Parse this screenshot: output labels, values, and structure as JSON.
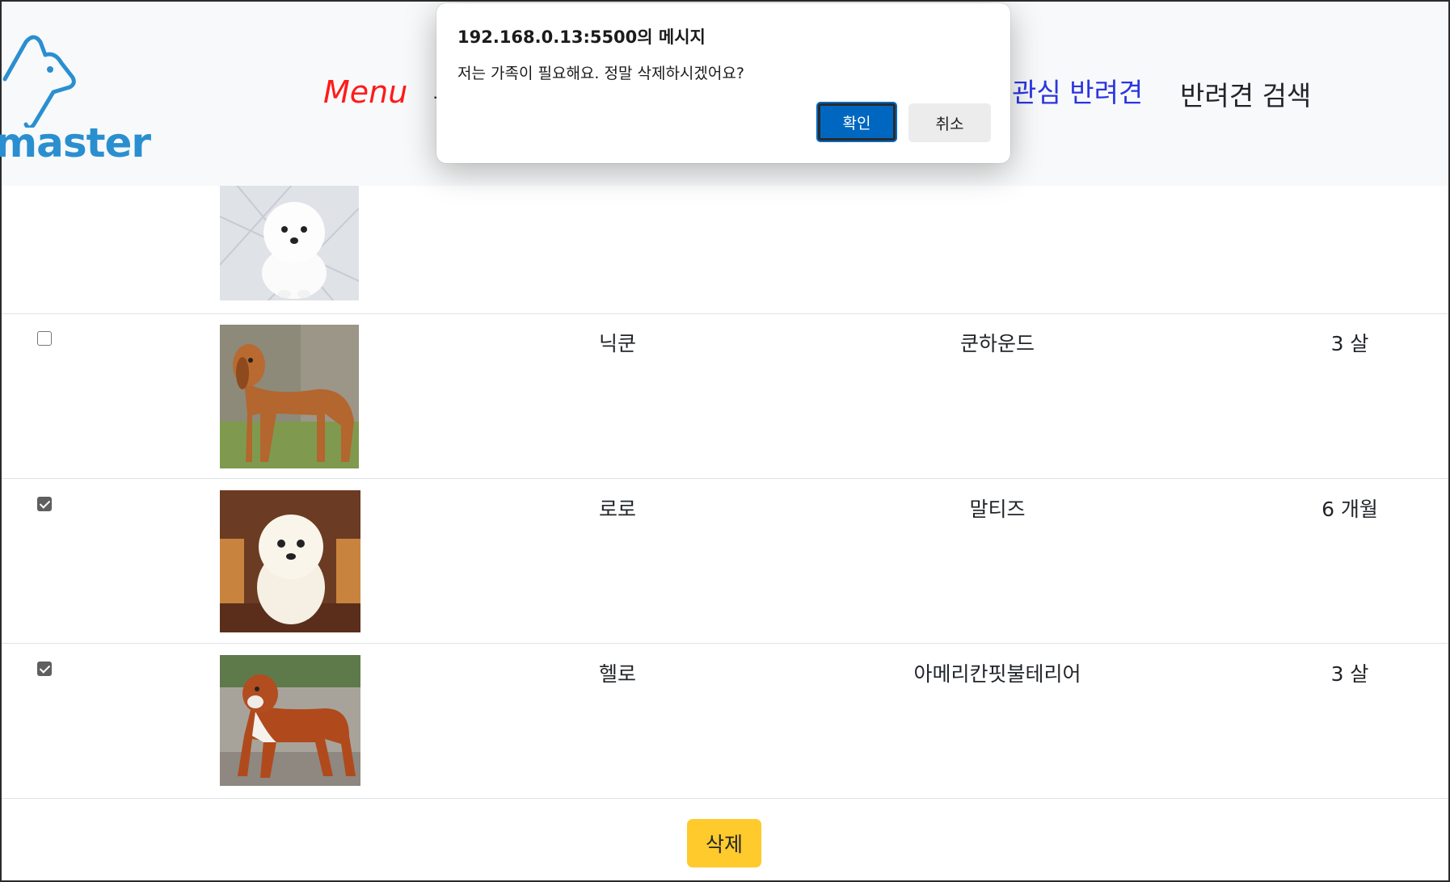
{
  "dialog": {
    "title": "192.168.0.13:5500의 메시지",
    "message": "저는 가족이 필요해요. 정말 삭제하시겠어요?",
    "ok_label": "확인",
    "cancel_label": "취소"
  },
  "navbar": {
    "logo_text": "master",
    "menu_label": "Menu",
    "favorites_label": "관심 반려견",
    "search_label": "반려견 검색"
  },
  "pets": [
    {
      "name": "",
      "breed": "",
      "age": "",
      "checked": false
    },
    {
      "name": "닉쿤",
      "breed": "쿤하운드",
      "age": "3 살",
      "checked": false
    },
    {
      "name": "로로",
      "breed": "말티즈",
      "age": "6 개월",
      "checked": true
    },
    {
      "name": "헬로",
      "breed": "아메리칸핏불테리어",
      "age": "3 살",
      "checked": true
    }
  ],
  "delete_button_label": "삭제",
  "colors": {
    "menu": "#ff1a1a",
    "favorites_link": "#2a35e0",
    "logo": "#2a8fd0",
    "delete_button": "#ffca2c",
    "dialog_ok": "#0067c0"
  }
}
